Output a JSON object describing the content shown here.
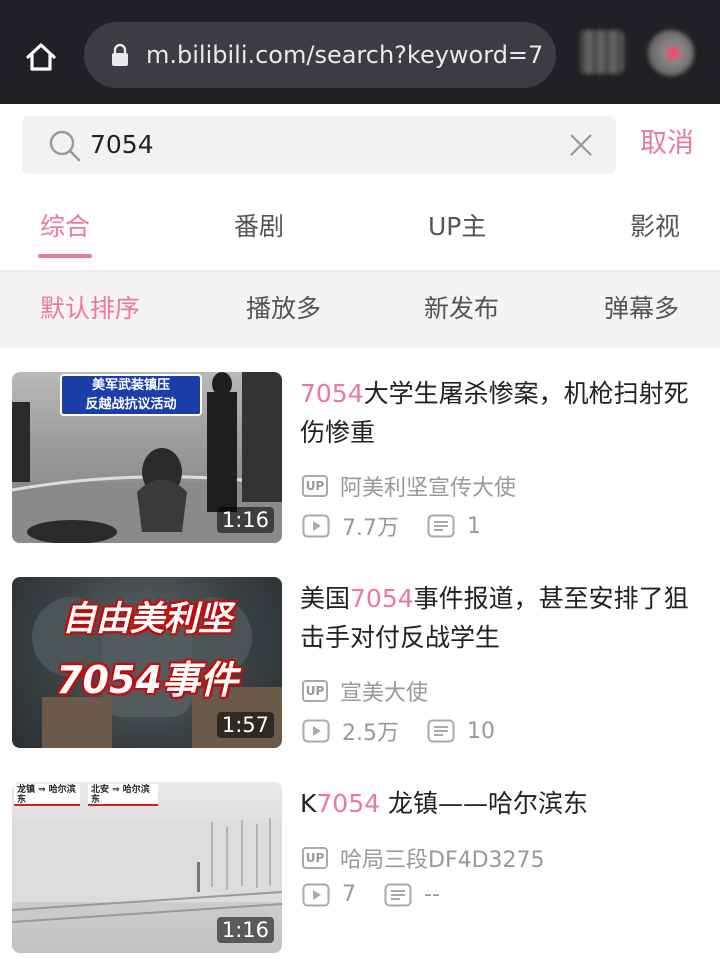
{
  "browser": {
    "url": "m.bilibili.com/search?keyword=7"
  },
  "search": {
    "query": "7054",
    "cancel_label": "取消"
  },
  "tabs": [
    {
      "label": "综合",
      "active": true
    },
    {
      "label": "番剧",
      "active": false
    },
    {
      "label": "UP主",
      "active": false
    },
    {
      "label": "影视",
      "active": false
    }
  ],
  "sort": [
    {
      "label": "默认排序",
      "active": true
    },
    {
      "label": "播放多",
      "active": false
    },
    {
      "label": "新发布",
      "active": false
    },
    {
      "label": "弹幕多",
      "active": false
    }
  ],
  "results": [
    {
      "title_highlight": "7054",
      "title_rest": "大学生屠杀惨案，机枪扫射死伤惨重",
      "title_prefix": "",
      "uploader": "阿美利坚宣传大使",
      "views": "7.7万",
      "danmaku": "1",
      "duration": "1:16",
      "thumb_text": [
        "美军武装镇压",
        "反越战抗议活动"
      ]
    },
    {
      "title_prefix": "美国",
      "title_highlight": "7054",
      "title_rest": "事件报道，甚至安排了狙击手对付反战学生",
      "uploader": "宣美大使",
      "views": "2.5万",
      "danmaku": "10",
      "duration": "1:57",
      "thumb_text": [
        "自由美利坚",
        "7054事件"
      ]
    },
    {
      "title_prefix": "K",
      "title_highlight": "7054",
      "title_rest": " 龙镇——哈尔滨东",
      "uploader": "哈局三段DF4D3275",
      "views": "7",
      "danmaku": "--",
      "duration": "1:16",
      "thumb_text": [
        "龙镇 ⇒ 哈尔滨东",
        "北安 ⇒ 哈尔滨东"
      ]
    }
  ],
  "labels": {
    "up_badge": "UP"
  },
  "colors": {
    "accent": "#ea7a99",
    "chrome_bg": "#202124"
  }
}
